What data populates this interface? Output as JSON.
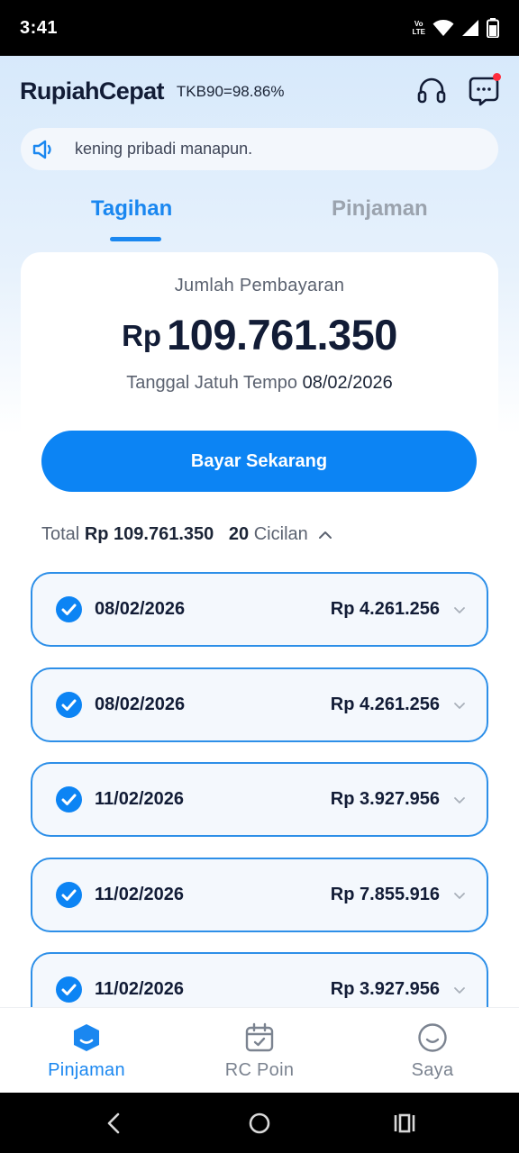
{
  "status_bar": {
    "time": "3:41",
    "volte_top": "Vo",
    "volte_bottom": "LTE",
    "icons": [
      "volte-icon",
      "wifi-icon",
      "signal-icon",
      "battery-icon"
    ]
  },
  "header": {
    "logo": "RupiahCepat",
    "tkb": "TKB90=98.86%",
    "icons": [
      "headset-icon",
      "chat-icon"
    ],
    "has_notification_dot": true
  },
  "notice": {
    "icon": "speaker-icon",
    "text": "kening pribadi manapun."
  },
  "tabs": [
    {
      "label": "Tagihan",
      "active": true
    },
    {
      "label": "Pinjaman",
      "active": false
    }
  ],
  "payment": {
    "label": "Jumlah Pembayaran",
    "currency": "Rp",
    "amount": "109.761.350",
    "due_label": "Tanggal Jatuh Tempo",
    "due_date": "08/02/2026",
    "pay_button": "Bayar Sekarang"
  },
  "summary": {
    "total_label": "Total",
    "total_value": "Rp 109.761.350",
    "count": "20",
    "count_label": "Cicilan",
    "expanded": true
  },
  "installments": [
    {
      "date": "08/02/2026",
      "amount": "Rp 4.261.256",
      "checked": true
    },
    {
      "date": "08/02/2026",
      "amount": "Rp 4.261.256",
      "checked": true
    },
    {
      "date": "11/02/2026",
      "amount": "Rp 3.927.956",
      "checked": true
    },
    {
      "date": "11/02/2026",
      "amount": "Rp 7.855.916",
      "checked": true
    },
    {
      "date": "11/02/2026",
      "amount": "Rp 3.927.956",
      "checked": true
    }
  ],
  "bottom_nav": [
    {
      "label": "Pinjaman",
      "icon": "shield-face-icon",
      "active": true
    },
    {
      "label": "RC Poin",
      "icon": "calendar-check-icon",
      "active": false
    },
    {
      "label": "Saya",
      "icon": "smiley-icon",
      "active": false
    }
  ],
  "system_nav": [
    "back-icon",
    "home-icon",
    "recents-icon"
  ],
  "colors": {
    "accent": "#1a87f0",
    "button": "#0c84f4",
    "text_dark": "#121c36",
    "muted": "#9ba3ae",
    "notification": "#ff2d3d"
  }
}
